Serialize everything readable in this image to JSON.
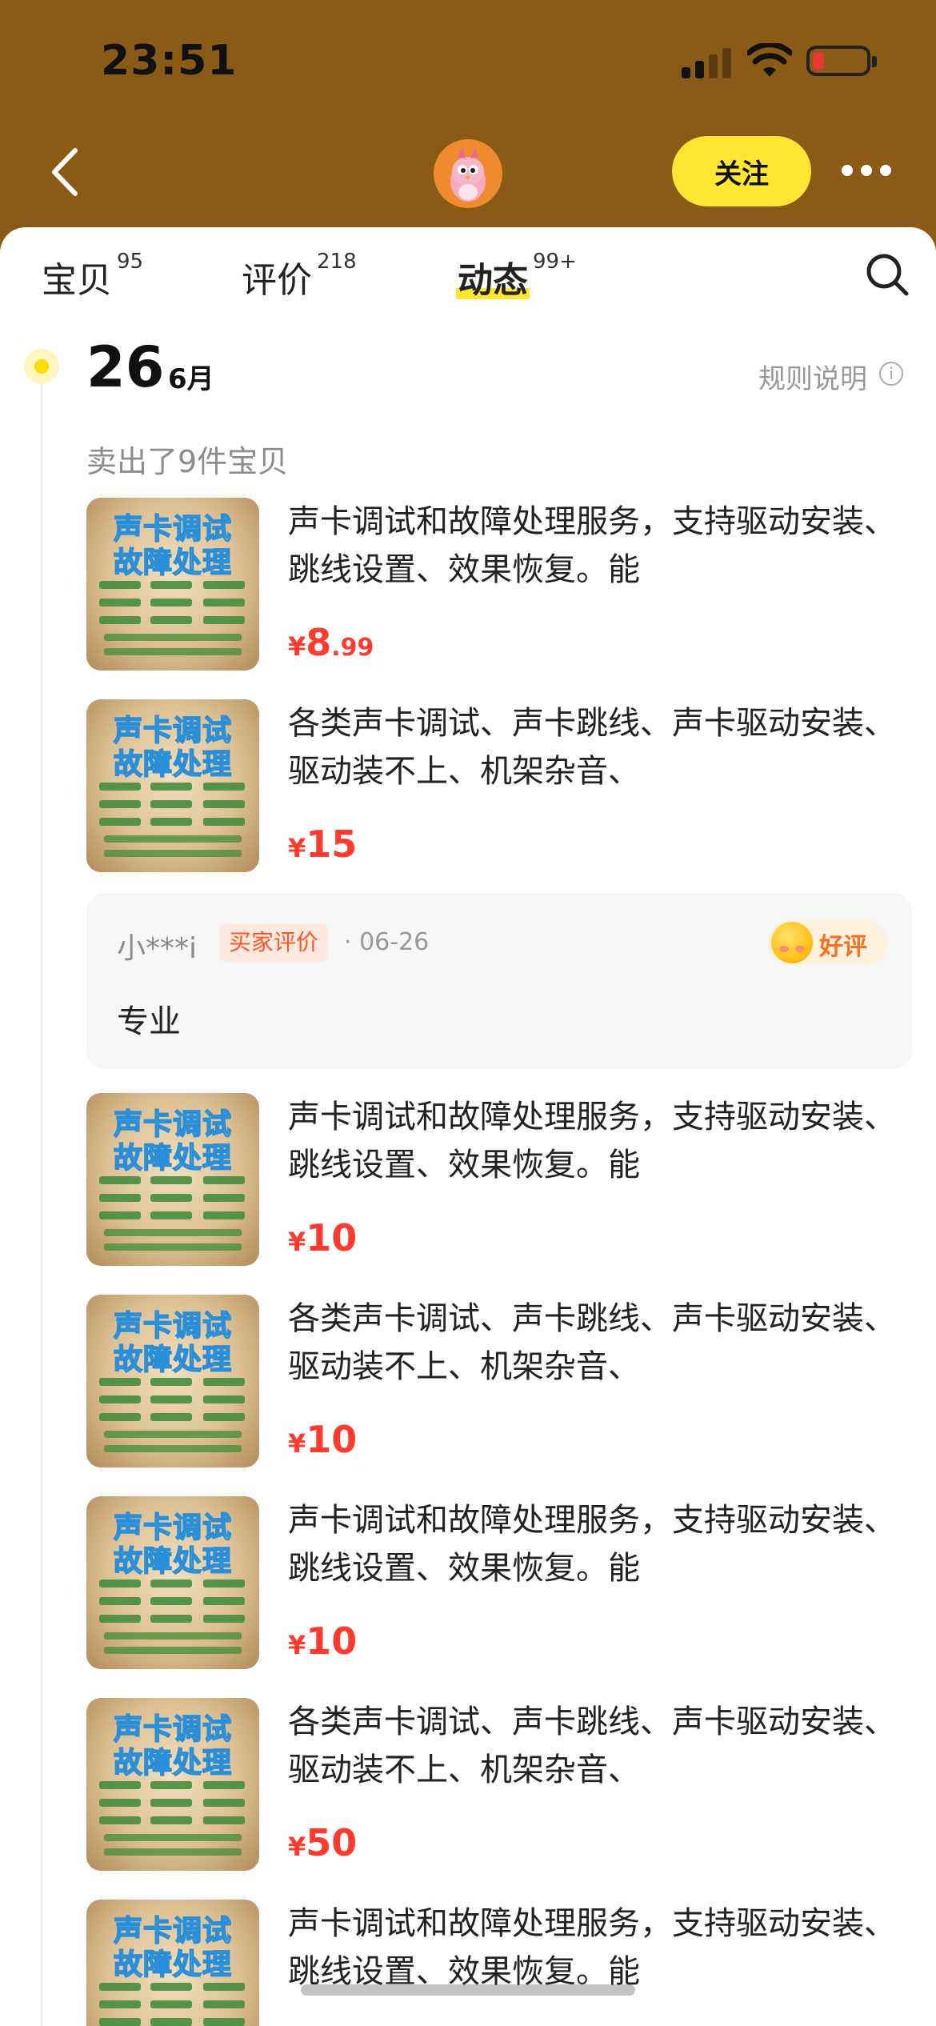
{
  "status_bar": {
    "time": "23:51"
  },
  "nav": {
    "follow_label": "关注"
  },
  "tabs": [
    {
      "label": "宝贝",
      "count": "95"
    },
    {
      "label": "评价",
      "count": "218"
    },
    {
      "label": "动态",
      "count": "99+"
    }
  ],
  "timeline": {
    "day": "26",
    "month": "6月",
    "rules_label": "规则说明",
    "sold_summary": "卖出了9件宝贝"
  },
  "thumbnail": {
    "line1": "声卡调试",
    "line2": "故障处理"
  },
  "items": [
    {
      "title": "声卡调试和故障处理服务，支持驱动安装、跳线设置、效果恢复。能",
      "currency": "¥",
      "price_int": "8",
      "price_dec": ".99"
    },
    {
      "title": "各类声卡调试、声卡跳线、声卡驱动安装、驱动装不上、机架杂音、",
      "currency": "¥",
      "price_int": "15",
      "price_dec": ""
    },
    {
      "title": "声卡调试和故障处理服务，支持驱动安装、跳线设置、效果恢复。能",
      "currency": "¥",
      "price_int": "10",
      "price_dec": ""
    },
    {
      "title": "各类声卡调试、声卡跳线、声卡驱动安装、驱动装不上、机架杂音、",
      "currency": "¥",
      "price_int": "10",
      "price_dec": ""
    },
    {
      "title": "声卡调试和故障处理服务，支持驱动安装、跳线设置、效果恢复。能",
      "currency": "¥",
      "price_int": "10",
      "price_dec": ""
    },
    {
      "title": "各类声卡调试、声卡跳线、声卡驱动安装、驱动装不上、机架杂音、",
      "currency": "¥",
      "price_int": "50",
      "price_dec": ""
    },
    {
      "title": "声卡调试和故障处理服务，支持驱动安装、跳线设置、效果恢复。能",
      "currency": "¥",
      "price_int": "",
      "price_dec": ""
    }
  ],
  "review": {
    "user": "小***i",
    "badge": "买家评价",
    "date": "· 06-26",
    "rating": "好评",
    "text": "专业"
  },
  "colors": {
    "header_bg": "#8a5a17",
    "accent_yellow": "#ffe633",
    "price_red": "#ff3b30"
  }
}
